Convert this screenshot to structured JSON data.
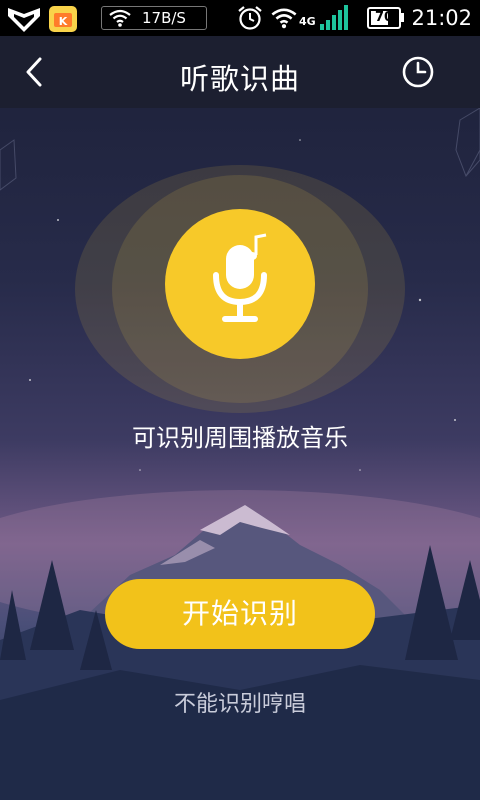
{
  "status_bar": {
    "speed": "17B/S",
    "network": "4G",
    "battery": "70",
    "battery_level": 0.7,
    "time": "21:02",
    "icons": [
      "shield-icon",
      "app-store-icon",
      "wifi-icon",
      "alarm-icon",
      "signal-icon",
      "battery-icon"
    ]
  },
  "header": {
    "title": "听歌识曲",
    "back_icon": "chevron-left-icon",
    "history_icon": "clock-icon"
  },
  "main": {
    "mic_icon": "microphone-music-icon",
    "hint": "可识别周围播放音乐",
    "start_button": "开始识别",
    "humming_note": "不能识别哼唱"
  },
  "colors": {
    "accent": "#f7c929",
    "button": "#f2c21a",
    "header_bg": "#1c1f30",
    "status_bg": "#000000"
  }
}
